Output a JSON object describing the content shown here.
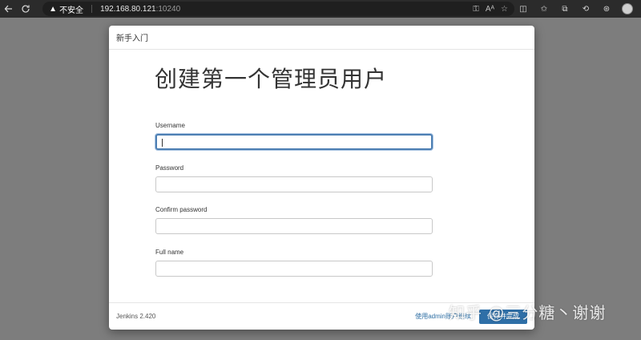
{
  "browser": {
    "security_label": "不安全",
    "url_host": "192.168.80.121",
    "url_port": ":10240"
  },
  "modal": {
    "header_title": "新手入门",
    "page_title": "创建第一个管理员用户",
    "fields": [
      {
        "label": "Username",
        "value": ""
      },
      {
        "label": "Password",
        "value": ""
      },
      {
        "label": "Confirm password",
        "value": ""
      },
      {
        "label": "Full name",
        "value": ""
      }
    ],
    "footer": {
      "version": "Jenkins 2.420",
      "admin_link": "使用admin账户继续",
      "save_button": "保存并完成"
    }
  },
  "watermark": "知乎 @三分糖丶谢谢"
}
